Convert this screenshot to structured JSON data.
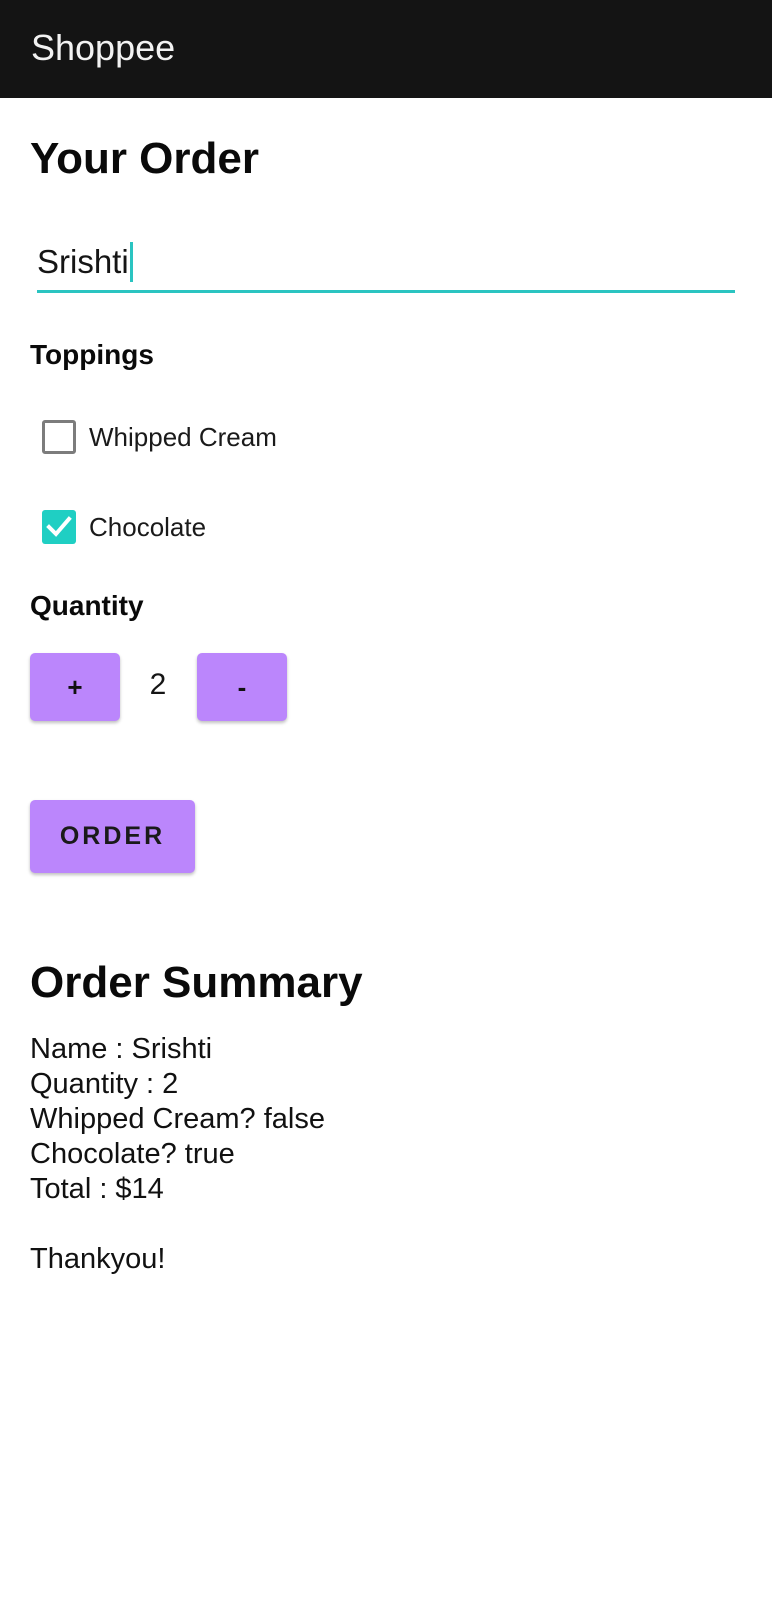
{
  "app": {
    "title": "Shoppee"
  },
  "order_form": {
    "heading": "Your Order",
    "name_value": "Srishti",
    "toppings_label": "Toppings",
    "toppings": [
      {
        "label": "Whipped Cream",
        "checked": false
      },
      {
        "label": "Chocolate",
        "checked": true
      }
    ],
    "quantity_label": "Quantity",
    "increment_label": "+",
    "quantity_value": "2",
    "decrement_label": "-",
    "order_button_label": "ORDER"
  },
  "summary": {
    "heading": "Order Summary",
    "lines": [
      "Name : Srishti",
      "Quantity : 2",
      "Whipped Cream? false",
      "Chocolate? true",
      "Total : $14"
    ],
    "thanks": "Thankyou!"
  },
  "colors": {
    "appbar": "#141414",
    "accent": "#2ac4c1",
    "button": "#bb86fc",
    "checkbox_checked": "#1fcfc3"
  }
}
